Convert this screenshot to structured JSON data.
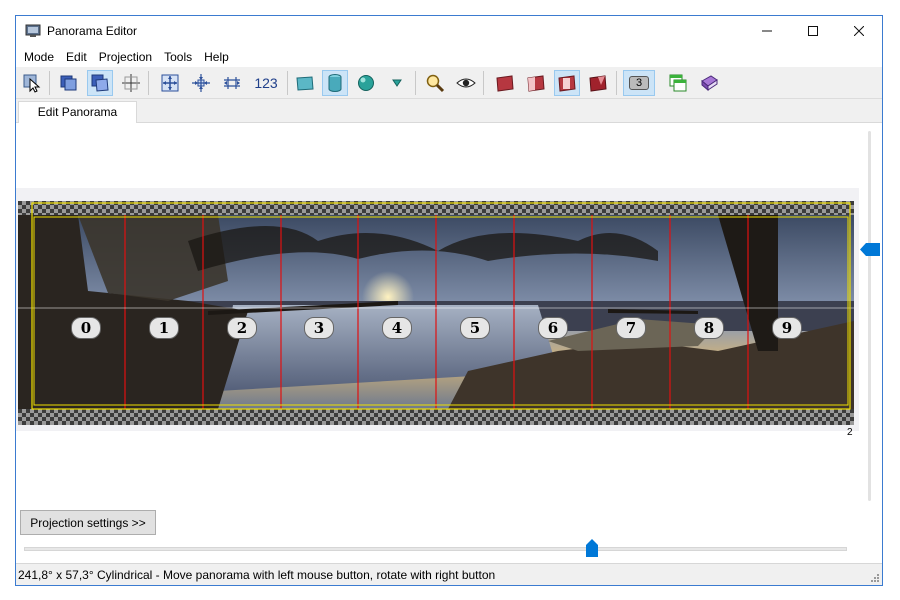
{
  "window": {
    "title": "Panorama Editor",
    "minimize": "—",
    "maximize": "☐",
    "close": "✕"
  },
  "menu": [
    "Mode",
    "Edit",
    "Projection",
    "Tools",
    "Help"
  ],
  "toolbar": {
    "number_label": "123",
    "layer_badge": "3"
  },
  "tabs": [
    {
      "label": "Edit Panorama",
      "selected": true
    }
  ],
  "panorama": {
    "image_numbers": [
      "0",
      "1",
      "2",
      "3",
      "4",
      "5",
      "6",
      "7",
      "8",
      "9"
    ],
    "corner_marker": "2"
  },
  "projection_button": "Projection settings >>",
  "horizontal_slider": {
    "value": 0.69
  },
  "vertical_slider": {
    "value": 0.32
  },
  "status": "241,8° x 57,3° Cylindrical - Move panorama with left mouse button, rotate with right button"
}
